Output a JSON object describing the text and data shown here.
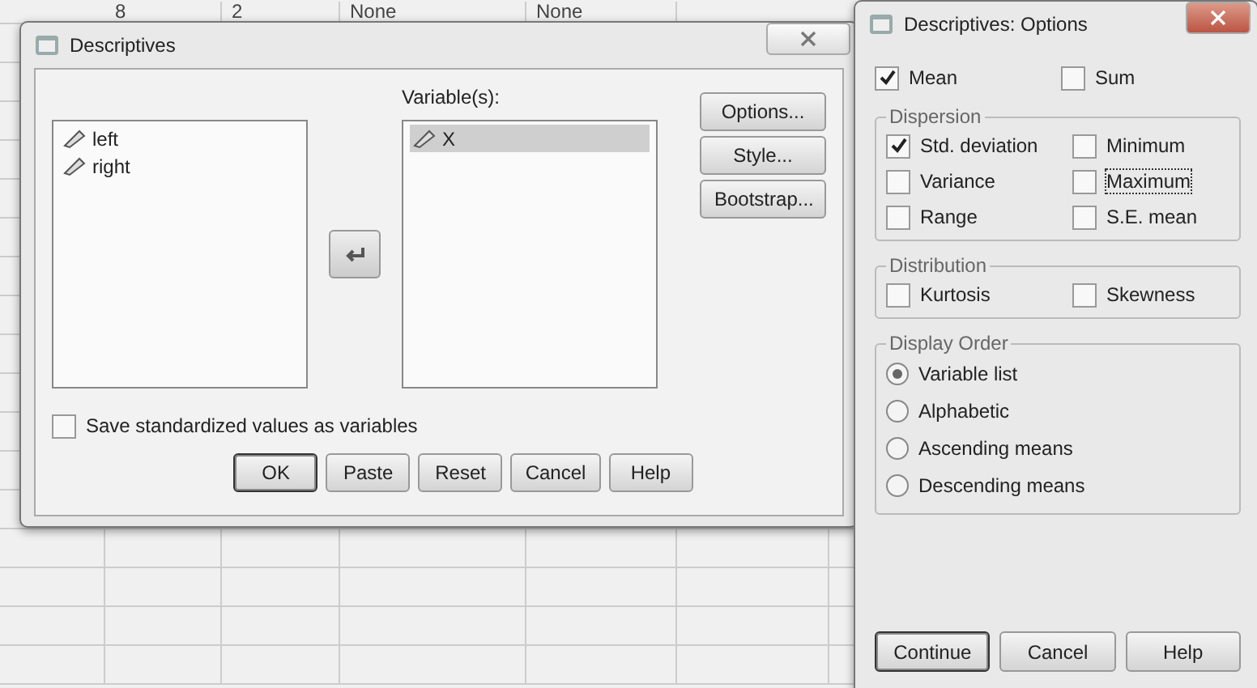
{
  "background_sheet": {
    "first_row": [
      "8",
      "2",
      "None",
      "None"
    ]
  },
  "descriptives_dialog": {
    "title": "Descriptives",
    "source_variables": [
      {
        "name": "left",
        "selected": false
      },
      {
        "name": "right",
        "selected": false
      }
    ],
    "variables_label": "Variable(s):",
    "selected_variables": [
      {
        "name": "X",
        "selected": true
      }
    ],
    "side_buttons": [
      "Options...",
      "Style...",
      "Bootstrap..."
    ],
    "save_checkbox": {
      "label": "Save standardized values as variables",
      "checked": false
    },
    "buttons": [
      {
        "label": "OK",
        "default": true
      },
      {
        "label": "Paste",
        "default": false
      },
      {
        "label": "Reset",
        "default": false
      },
      {
        "label": "Cancel",
        "default": false
      },
      {
        "label": "Help",
        "default": false
      }
    ]
  },
  "options_dialog": {
    "title": "Descriptives: Options",
    "top_checks": [
      {
        "label": "Mean",
        "checked": true,
        "focused": false
      },
      {
        "label": "Sum",
        "checked": false,
        "focused": false
      }
    ],
    "dispersion": {
      "title": "Dispersion",
      "items": [
        {
          "label": "Std. deviation",
          "checked": true,
          "focused": false
        },
        {
          "label": "Minimum",
          "checked": false,
          "focused": false
        },
        {
          "label": "Variance",
          "checked": false,
          "focused": false
        },
        {
          "label": "Maximum",
          "checked": false,
          "focused": true
        },
        {
          "label": "Range",
          "checked": false,
          "focused": false
        },
        {
          "label": "S.E. mean",
          "checked": false,
          "focused": false
        }
      ]
    },
    "distribution": {
      "title": "Distribution",
      "items": [
        {
          "label": "Kurtosis",
          "checked": false,
          "focused": false
        },
        {
          "label": "Skewness",
          "checked": false,
          "focused": false
        }
      ]
    },
    "display_order": {
      "title": "Display Order",
      "options": [
        {
          "label": "Variable list",
          "selected": true
        },
        {
          "label": "Alphabetic",
          "selected": false
        },
        {
          "label": "Ascending means",
          "selected": false
        },
        {
          "label": "Descending means",
          "selected": false
        }
      ]
    },
    "buttons": [
      {
        "label": "Continue",
        "default": true
      },
      {
        "label": "Cancel",
        "default": false
      },
      {
        "label": "Help",
        "default": false
      }
    ]
  }
}
